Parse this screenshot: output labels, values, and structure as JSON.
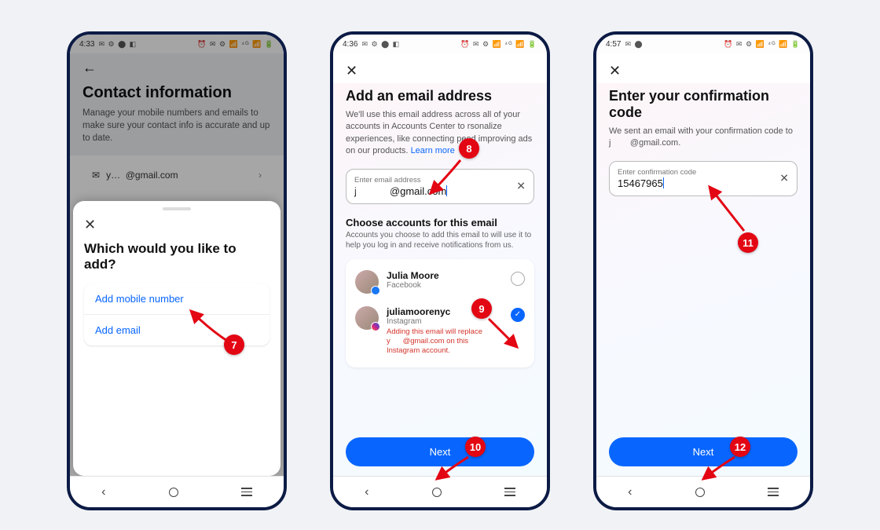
{
  "phone1": {
    "status_time": "4:33",
    "status_icons_left": "✉ ⚙ ⬤ ◧",
    "status_icons_right": "⏰ ✉ ⚙ 📶 ⁴ᴳ 📶 🔋",
    "header_title": "Contact information",
    "header_subtitle": "Manage your mobile numbers and emails to make sure your contact info is accurate and up to date.",
    "row_email_masked": "@gmail.com",
    "sheet": {
      "title": "Which would you like to add?",
      "options": [
        "Add mobile number",
        "Add email"
      ]
    }
  },
  "phone2": {
    "status_time": "4:36",
    "status_icons_left": "✉ ⚙ ⬤ ◧",
    "status_icons_right": "⏰ ✉ ⚙ 📶 ⁴ᴳ 📶 🔋",
    "title": "Add an email address",
    "desc_pre": "We'll use this email address across all of your accounts in Accounts Center to ",
    "desc_mid": "rsonalize experiences, like connecting peo",
    "desc_post": "d improving ads on our products. ",
    "learn_more": "Learn more",
    "input_label": "Enter email address",
    "input_prefix": "j",
    "input_suffix": "@gmail.com",
    "choose_title": "Choose accounts for this email",
    "choose_sub": "Accounts you choose to add this email to will use it to help you log in and receive notifications from us.",
    "accounts": [
      {
        "name": "Julia Moore",
        "platform": "Facebook",
        "checked": false
      },
      {
        "name": "juliamoorenyc",
        "platform": "Instagram",
        "checked": true,
        "warning_pre": "Adding this email will replace y",
        "warning_post": "@gmail.com on this Instagram account."
      }
    ],
    "next": "Next"
  },
  "phone3": {
    "status_time": "4:57",
    "status_icons_left": "✉ ⬤",
    "status_icons_right": "⏰ ✉ ⚙ 📶 ⁴ᴳ 📶 🔋",
    "title": "Enter your confirmation code",
    "desc_pre": "We sent an email with your confirmation code to j",
    "desc_post": "@gmail.com.",
    "input_label": "Enter confirmation code",
    "input_value": "15467965",
    "next": "Next"
  },
  "markers": {
    "m7": "7",
    "m8": "8",
    "m9": "9",
    "m10": "10",
    "m11": "11",
    "m12": "12"
  }
}
